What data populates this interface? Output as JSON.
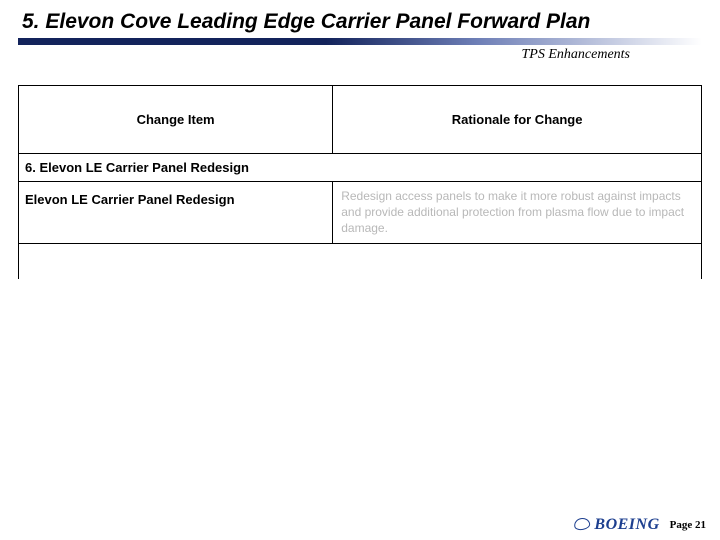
{
  "title": "5.  Elevon Cove Leading Edge Carrier Panel Forward Plan",
  "subtitle": "TPS Enhancements",
  "table": {
    "headers": {
      "left": "Change Item",
      "right": "Rationale for Change"
    },
    "section": "6.  Elevon LE Carrier Panel Redesign",
    "row": {
      "left": "Elevon LE Carrier Panel Redesign",
      "right": "Redesign access panels to make it more robust against impacts and provide additional protection from plasma flow due to impact damage."
    }
  },
  "footer": {
    "logo": "BOEING",
    "page": "Page 21"
  }
}
